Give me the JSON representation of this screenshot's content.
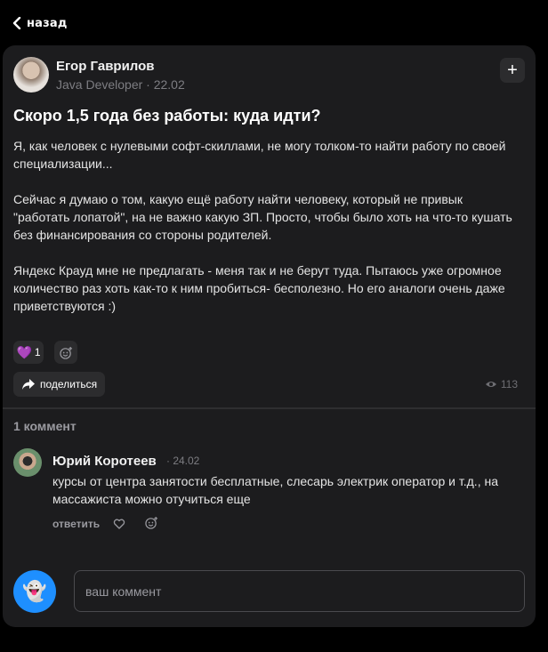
{
  "nav": {
    "back_label": "назад"
  },
  "post": {
    "author": "Егор Гаврилов",
    "meta": "Java Developer · 22.02",
    "plus": "+",
    "title": "Скоро 1,5 года без работы: куда идти?",
    "paragraphs": [
      "Я, как человек с нулевыми софт-скиллами, не могу толком-то найти работу по своей специализации...",
      "Сейчас я думаю о том, какую ещё работу найти человеку, который не привык \"работать лопатой\", на не важно какую ЗП. Просто, чтобы было хоть на что-то кушать без финансирования со стороны родителей.",
      "Яндекс Крауд мне не предлагать - меня так и не берут туда. Пытаюсь уже огромное количество раз хоть как-то к ним пробиться- бесполезно. Но его аналоги очень даже приветствуются :)"
    ],
    "reaction": {
      "emoji": "💜",
      "count": "1"
    },
    "share_label": "поделиться",
    "views": "113"
  },
  "comments": {
    "count_label": "1 коммент",
    "items": [
      {
        "author": "Юрий Коротеев",
        "date": "· 24.02",
        "text": "курсы от центра занятости бесплатные, слесарь электрик оператор и т.д., на массажиста можно отучиться еще",
        "reply_label": "ответить"
      }
    ]
  },
  "composer": {
    "avatar_emoji": "👻",
    "placeholder": "ваш коммент"
  },
  "colors": {
    "background": "#000000",
    "card": "#1c1c1e",
    "accent": "#1e8fff",
    "reaction": "#a259ff"
  }
}
